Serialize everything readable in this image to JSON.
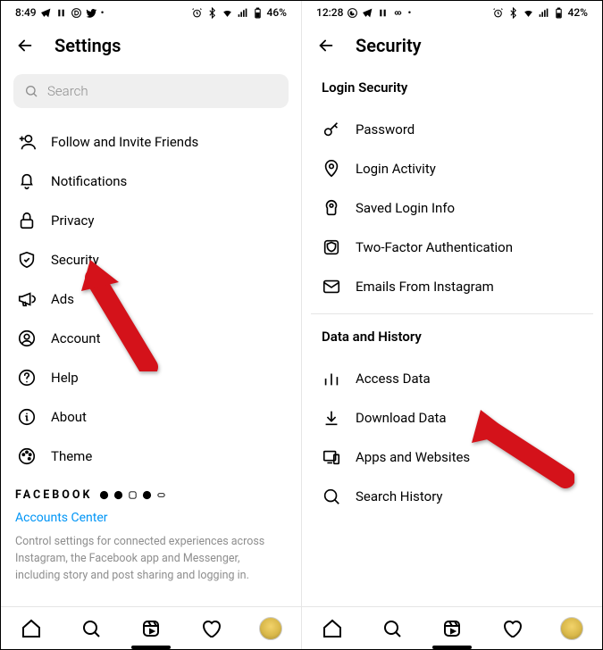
{
  "left": {
    "statusbar": {
      "time": "8:49",
      "battery": "46%"
    },
    "header": {
      "title": "Settings"
    },
    "search": {
      "placeholder": "Search"
    },
    "items": [
      {
        "label": "Follow and Invite Friends"
      },
      {
        "label": "Notifications"
      },
      {
        "label": "Privacy"
      },
      {
        "label": "Security"
      },
      {
        "label": "Ads"
      },
      {
        "label": "Account"
      },
      {
        "label": "Help"
      },
      {
        "label": "About"
      },
      {
        "label": "Theme"
      }
    ],
    "fb": {
      "brand": "FACEBOOK",
      "link": "Accounts Center",
      "desc": "Control settings for connected experiences across Instagram, the Facebook app and Messenger, including story and post sharing and logging in."
    }
  },
  "right": {
    "statusbar": {
      "time": "12:28",
      "battery": "42%"
    },
    "header": {
      "title": "Security"
    },
    "sections": {
      "login": {
        "title": "Login Security",
        "items": [
          {
            "label": "Password"
          },
          {
            "label": "Login Activity"
          },
          {
            "label": "Saved Login Info"
          },
          {
            "label": "Two-Factor Authentication"
          },
          {
            "label": "Emails From Instagram"
          }
        ]
      },
      "data": {
        "title": "Data and History",
        "items": [
          {
            "label": "Access Data"
          },
          {
            "label": "Download Data"
          },
          {
            "label": "Apps and Websites"
          },
          {
            "label": "Search History"
          }
        ]
      }
    }
  }
}
